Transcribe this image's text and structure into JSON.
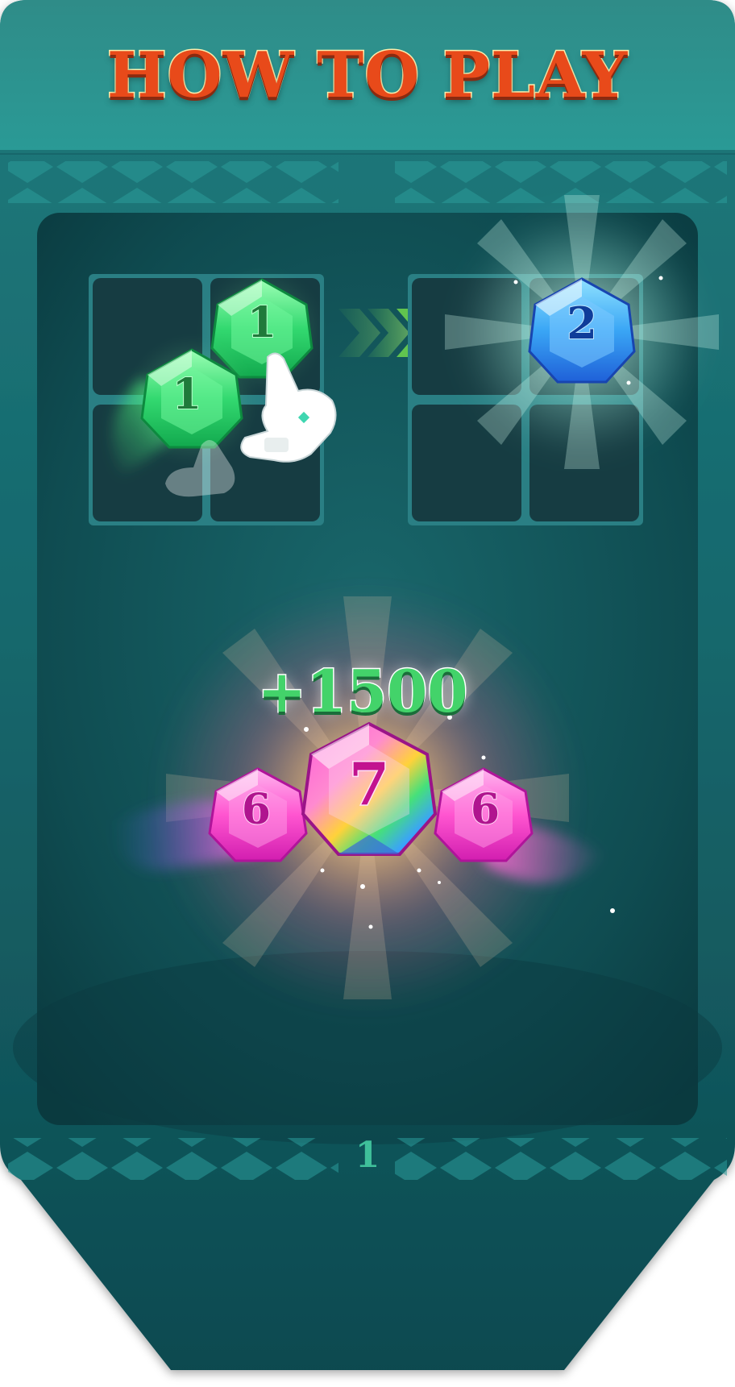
{
  "header": {
    "title": "HOW TO PLAY"
  },
  "tutorial": {
    "merge_example": {
      "source_gems": [
        {
          "value": "1",
          "color": "#3be07a"
        },
        {
          "value": "1",
          "color": "#3be07a"
        }
      ],
      "result_gem": {
        "value": "2",
        "color": "#2f8cf0"
      },
      "arrow_color": "#8cff4a",
      "pointer_icon": "hand-pointer-icon"
    },
    "combo_example": {
      "score": "+1500",
      "center_gem": {
        "value": "7",
        "color": "#ff3fd0"
      },
      "side_gems": [
        {
          "value": "6",
          "color": "#ff55cc"
        },
        {
          "value": "6",
          "color": "#ff55cc"
        }
      ]
    }
  },
  "pager": {
    "page": "1"
  },
  "colors": {
    "banner": "#166a6e",
    "panel": "#0f4a4f",
    "title": "#e84a1a",
    "page_number": "#3fbf9a"
  }
}
